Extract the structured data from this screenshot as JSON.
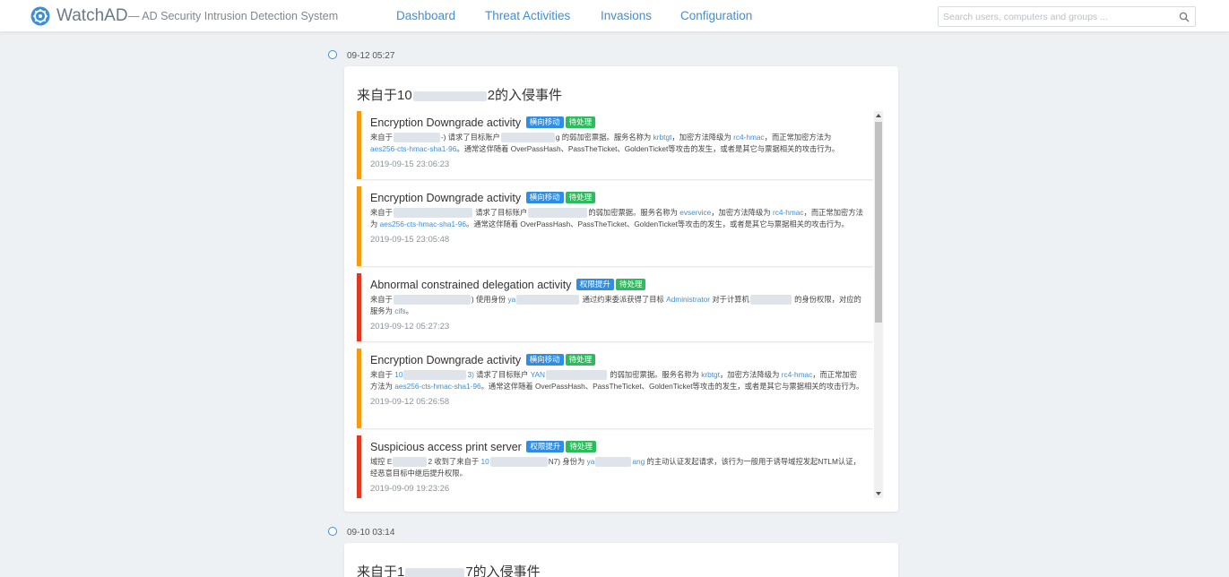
{
  "header": {
    "brand": "WatchAD",
    "subtitle": "— AD Security Intrusion Detection System",
    "nav": [
      "Dashboard",
      "Threat Activities",
      "Invasions",
      "Configuration"
    ],
    "search_placeholder": "Search users, computers and groups ..."
  },
  "invasions": [
    {
      "date": "09-12 05:27",
      "title_prefix": "来自于10",
      "title_suffix": "2的入侵事件",
      "events": [
        {
          "severity": "orange",
          "title": "Encryption Downgrade activity",
          "tags": [
            {
              "label": "横向移动",
              "color": "blue"
            },
            {
              "label": "待处理",
              "color": "green"
            }
          ],
          "d": [
            "来自于",
            "-) 请求了目标账户",
            "g 的弱加密票据。服务名称为",
            "krbtgt",
            "，加密方法降级为",
            "rc4-hmac",
            "，而正常加密方法为",
            "aes256-cts-hmac-sha1-96",
            "。通常这伴随着 OverPassHash、PassTheTicket、GoldenTicket等攻击的发生，或者是其它与票据相关的攻击行为。"
          ],
          "time": "2019-09-15 23:06:23"
        },
        {
          "severity": "orange",
          "title": "Encryption Downgrade activity",
          "tags": [
            {
              "label": "横向移动",
              "color": "blue"
            },
            {
              "label": "待处理",
              "color": "green"
            }
          ],
          "d": [
            "来自于",
            "请求了目标账户",
            "的弱加密票据。服务名称为",
            "evservice",
            "，加密方法降级为",
            "rc4-hmac",
            "，而正常加密方法为",
            "aes256-cts-hmac-sha1-96",
            "。通常这伴随着 OverPassHash、PassTheTicket、GoldenTicket等攻击的发生，或者是其它与票据相关的攻击行为。"
          ],
          "time": "2019-09-15 23:05:48"
        },
        {
          "severity": "red",
          "title": "Abnormal constrained delegation activity",
          "tags": [
            {
              "label": "权限提升",
              "color": "blue"
            },
            {
              "label": "待处理",
              "color": "green"
            }
          ],
          "d": [
            "来自于",
            ") 使用身份",
            "ya",
            "通过约束委派获得了目标",
            "Administrator",
            "对于计算机",
            "的身份权限，对应的服务为",
            "cifs",
            "。"
          ],
          "time": "2019-09-12 05:27:23"
        },
        {
          "severity": "orange",
          "title": "Encryption Downgrade activity",
          "tags": [
            {
              "label": "横向移动",
              "color": "blue"
            },
            {
              "label": "待处理",
              "color": "green"
            }
          ],
          "d": [
            "来自于",
            "10",
            "3)",
            "请求了目标账户",
            "YAN",
            "的弱加密票据。服务名称为",
            "krbtgt",
            "，加密方法降级为",
            "rc4-hmac",
            "，而正常加密方法为",
            "aes256-cts-hmac-sha1-96",
            "。通常这伴随着 OverPassHash、PassTheTicket、GoldenTicket等攻击的发生，或者是其它与票据相关的攻击行为。"
          ],
          "time": "2019-09-12 05:26:58"
        },
        {
          "severity": "red",
          "title": "Suspicious access print server",
          "tags": [
            {
              "label": "权限提升",
              "color": "blue"
            },
            {
              "label": "待处理",
              "color": "green"
            }
          ],
          "d": [
            "域控 E",
            "2 收到了来自于",
            "10",
            "N7)",
            "身份为",
            "ya",
            "ang",
            "的主动认证发起请求，该行为一般用于诱导域控发起NTLM认证，经恶意目标中继后提升权限。"
          ],
          "time": "2019-09-09 19:23:26"
        }
      ]
    },
    {
      "date": "09-10 03:14",
      "title_prefix": "来自于1",
      "title_suffix": "7的入侵事件"
    }
  ],
  "colors": {
    "accent": "#3d8fd8",
    "orange": "#f39c12",
    "red": "#e0391f",
    "tag_blue": "#2f8de4",
    "tag_green": "#2dbb5d"
  }
}
